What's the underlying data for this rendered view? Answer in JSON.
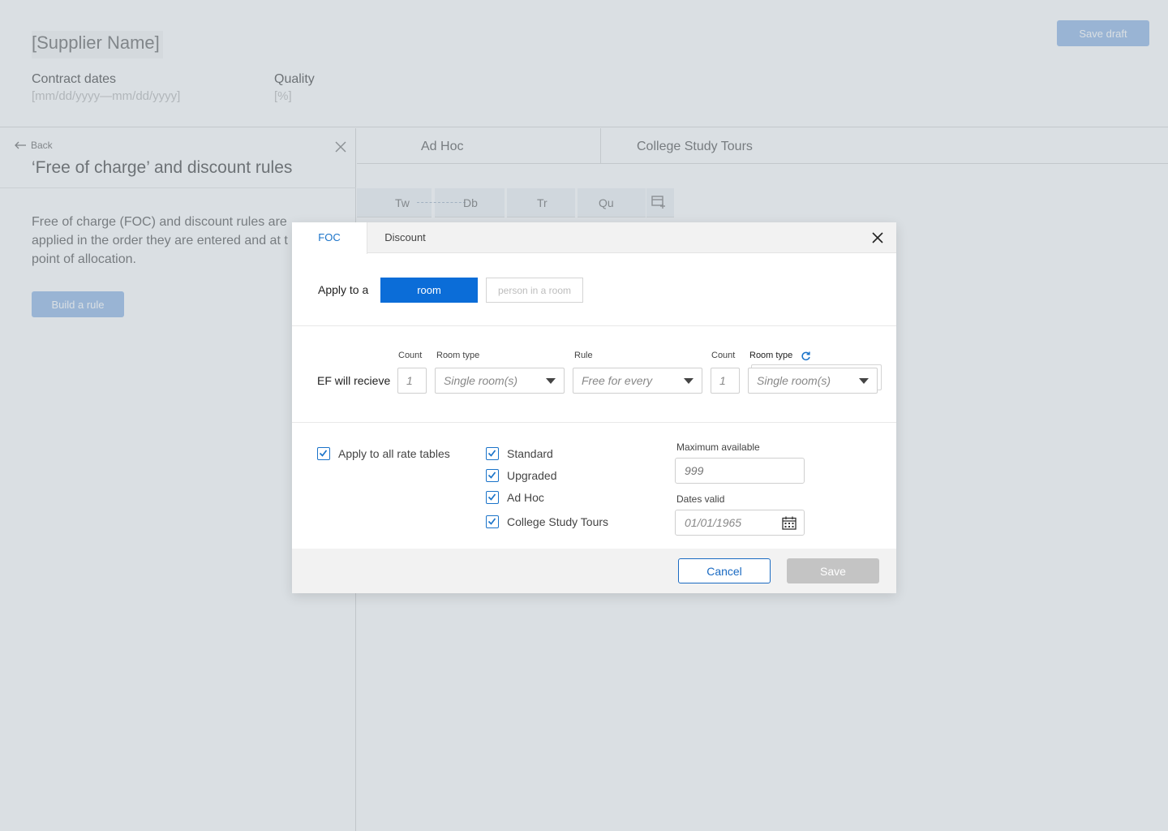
{
  "page": {
    "supplier_name": "[Supplier Name]",
    "contract_dates_label": "Contract dates",
    "contract_dates_value": "[mm/dd/yyyy—mm/dd/yyyy]",
    "quality_label": "Quality",
    "quality_value": "[%]",
    "save_draft_label": "Save draft",
    "tabs": [
      "Ad Hoc",
      "College Study Tours"
    ],
    "grid_columns": [
      "Tw",
      "Db",
      "Tr",
      "Qu"
    ]
  },
  "side_panel": {
    "back_label": "Back",
    "title": "‘Free of charge’ and discount rules",
    "description": "Free of charge (FOC) and discount rules are applied in the order they are entered and at t point of allocation.",
    "description_lines": [
      "Free of charge (FOC) and discount rules are",
      "applied in the order they are entered and at t",
      "point of allocation."
    ],
    "build_rule_label": "Build a rule"
  },
  "modal": {
    "tabs": [
      {
        "label": "FOC",
        "active": true
      },
      {
        "label": "Discount",
        "active": false
      }
    ],
    "apply_to_label": "Apply to a",
    "apply_options": [
      {
        "label": "room",
        "selected": true
      },
      {
        "label": "person in a room",
        "selected": false
      }
    ],
    "ef_label": "EF will recieve",
    "fields": {
      "count1_label": "Count",
      "count1_value": "1",
      "room_type1_label": "Room type",
      "room_type1_value": "Single room(s)",
      "rule_label": "Rule",
      "rule_value": "Free for every",
      "count2_label": "Count",
      "count2_value": "1",
      "room_type2_label": "Room type",
      "room_type2_value": "Single room(s)"
    },
    "apply_all_label": "Apply to all rate tables",
    "rate_tables": [
      {
        "label": "Standard",
        "checked": true
      },
      {
        "label": "Upgraded",
        "checked": true
      },
      {
        "label": "Ad Hoc",
        "checked": true
      },
      {
        "label": "College Study Tours",
        "checked": true
      }
    ],
    "max_available_label": "Maximum available",
    "max_available_placeholder": "999",
    "dates_valid_label": "Dates valid",
    "dates_valid_placeholder": "01/01/1965",
    "cancel_label": "Cancel",
    "save_label": "Save"
  },
  "colors": {
    "accent": "#0b6dd8",
    "disabled_button": "#c4c4c4",
    "overlay": "#a8b2bc"
  }
}
